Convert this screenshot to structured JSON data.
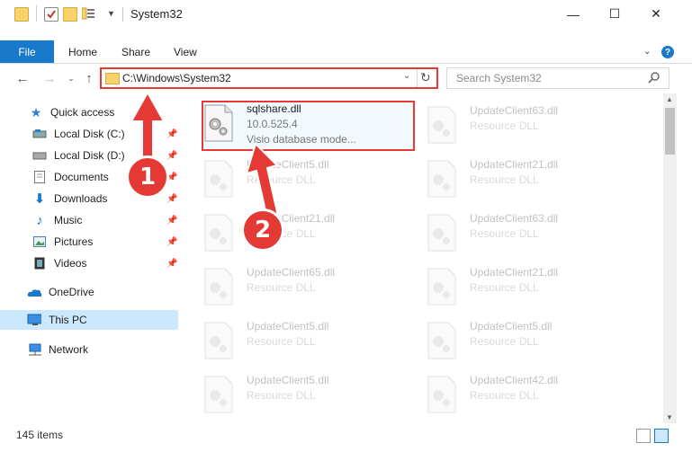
{
  "window": {
    "title": "System32",
    "minimize_glyph": "—",
    "maximize_glyph": "☐",
    "close_glyph": "✕"
  },
  "ribbon": {
    "tabs": [
      "File",
      "Home",
      "Share",
      "View"
    ],
    "help_glyph": "?",
    "collapse_glyph": "⌄"
  },
  "address": {
    "path": "C:\\Windows\\System32",
    "dropdown_glyph": "⌄",
    "refresh_glyph": "↻",
    "back_glyph": "←",
    "forward_glyph": "→",
    "recent_glyph": "⌄",
    "up_glyph": "↑"
  },
  "search": {
    "placeholder": "Search System32"
  },
  "nav": {
    "items": [
      {
        "label": "Quick access",
        "icon": "star-icon"
      },
      {
        "label": "Local Disk (C:)",
        "icon": "drive-icon",
        "pinned": true
      },
      {
        "label": "Local Disk (D:)",
        "icon": "drive-icon",
        "pinned": true
      },
      {
        "label": "Documents",
        "icon": "documents-icon",
        "pinned": true
      },
      {
        "label": "Downloads",
        "icon": "download-icon",
        "pinned": true
      },
      {
        "label": "Music",
        "icon": "music-icon",
        "pinned": true
      },
      {
        "label": "Pictures",
        "icon": "pictures-icon",
        "pinned": true
      },
      {
        "label": "Videos",
        "icon": "videos-icon",
        "pinned": true
      },
      {
        "label": "OneDrive",
        "icon": "cloud-icon"
      },
      {
        "label": "This PC",
        "icon": "computer-icon",
        "selected": true
      },
      {
        "label": "Network",
        "icon": "network-icon"
      }
    ],
    "pin_glyph": "📌"
  },
  "files": [
    {
      "name": "sqlshare.dll",
      "line2": "10.0.525.4",
      "line3": "Visio database mode..."
    },
    {
      "name": "UpdateClient63.dll",
      "line2": "Resource DLL"
    },
    {
      "name": "UpdateClient5.dll",
      "line2": "Resource DLL"
    },
    {
      "name": "UpdateClient21.dll",
      "line2": "Resource DLL"
    },
    {
      "name": "UpdateClient21.dll",
      "line2": "Resource DLL"
    },
    {
      "name": "UpdateClient63.dll",
      "line2": "Resource DLL"
    },
    {
      "name": "UpdateClient65.dll",
      "line2": "Resource DLL"
    },
    {
      "name": "UpdateClient21.dll",
      "line2": "Resource DLL"
    },
    {
      "name": "UpdateClient5.dll",
      "line2": "Resource DLL"
    },
    {
      "name": "UpdateClient5.dll",
      "line2": "Resource DLL"
    },
    {
      "name": "UpdateClient5.dll",
      "line2": "Resource DLL"
    },
    {
      "name": "UpdateClient42.dll",
      "line2": "Resource DLL"
    }
  ],
  "status": {
    "item_count": "145 items"
  },
  "annotations": {
    "step1": "1",
    "step2": "2",
    "color": "#e53935"
  }
}
